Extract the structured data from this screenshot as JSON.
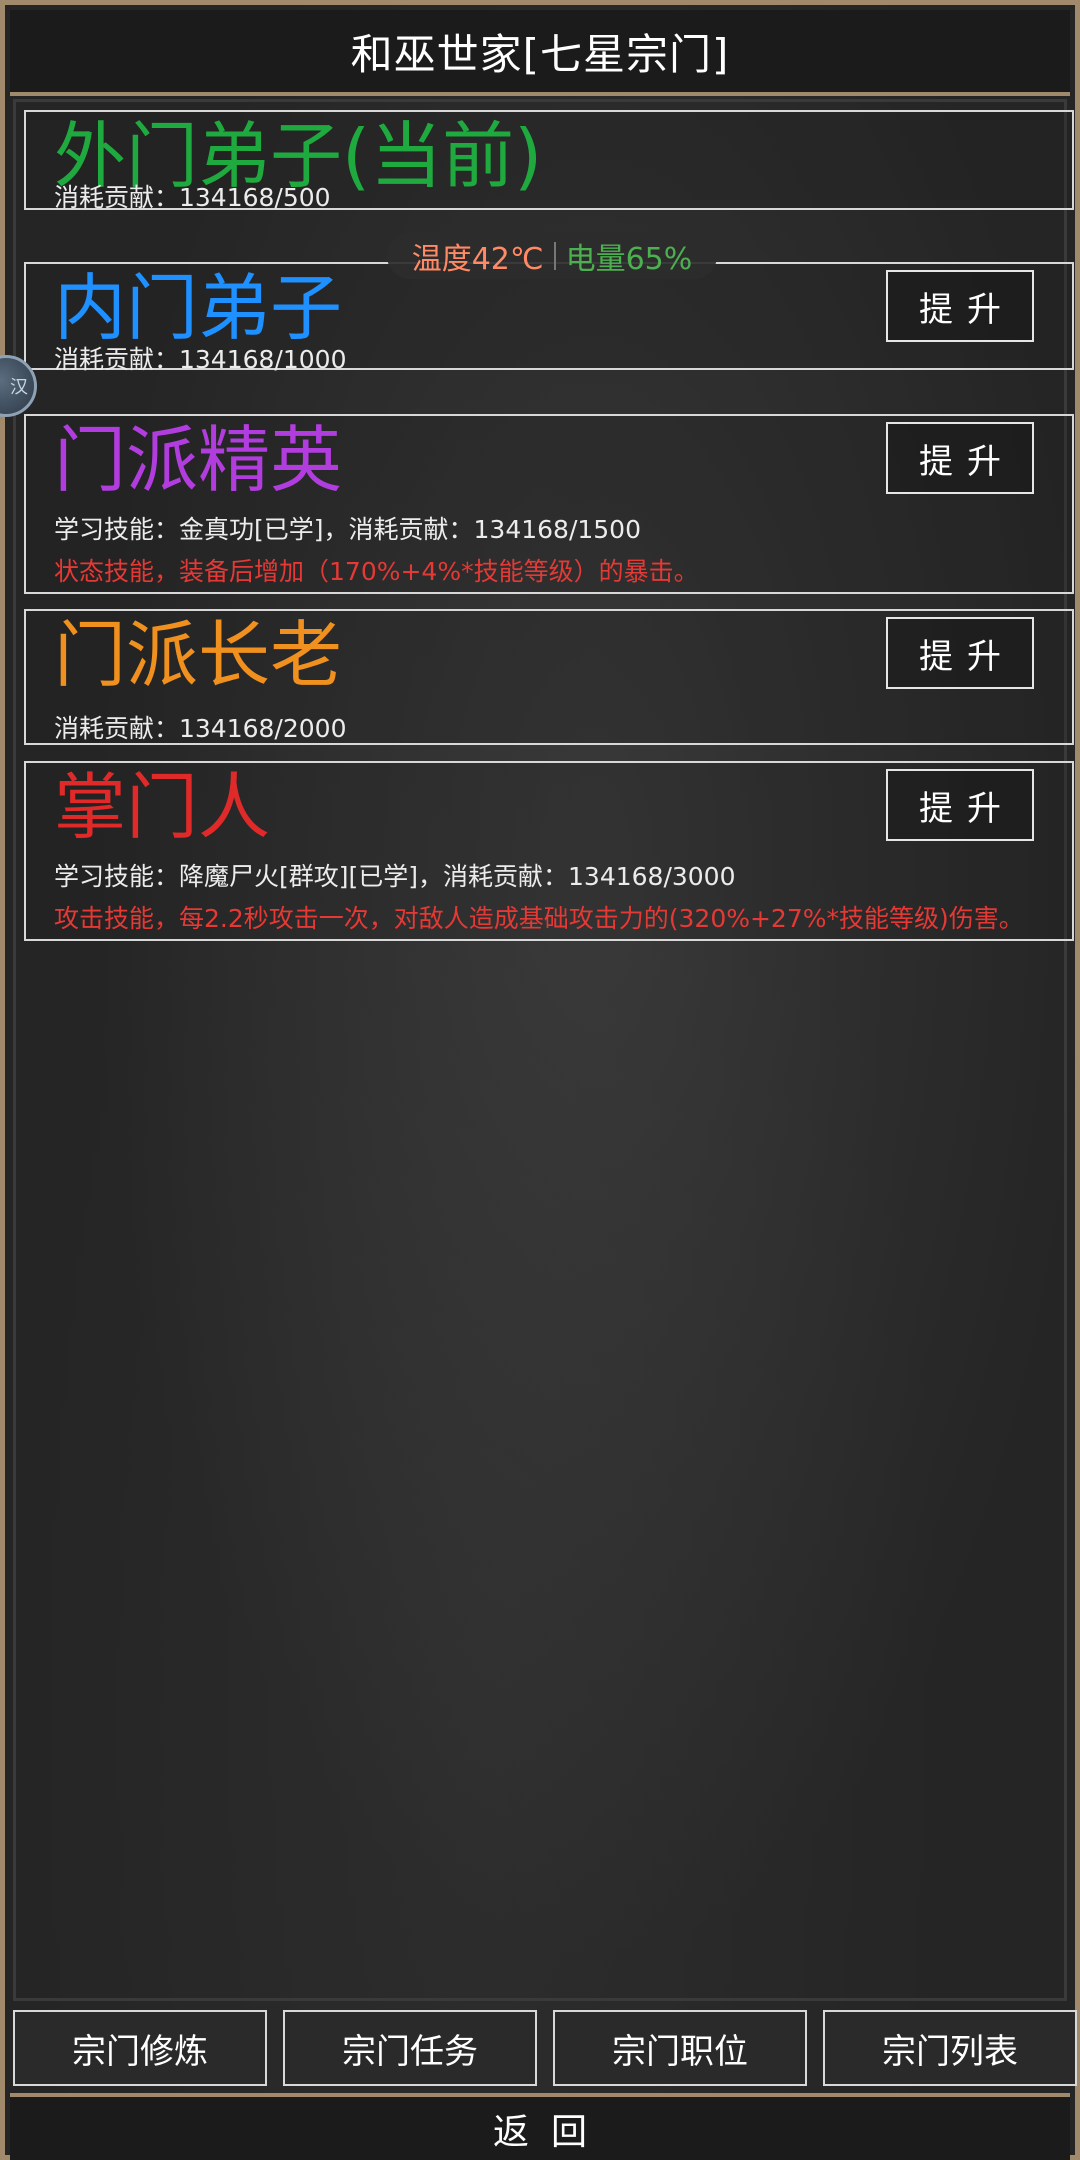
{
  "header": {
    "title": "和巫世家[七星宗门]"
  },
  "status": {
    "temperature": "温度42℃",
    "battery": "电量65%",
    "temperature_color": "#ff8a65",
    "battery_color": "#4caf50"
  },
  "float_button": {
    "label": "汉"
  },
  "ranks": [
    {
      "name": "外门弟子(当前)",
      "color": "#1faa3f",
      "info": "消耗贡献：134168/500",
      "desc": "",
      "button": ""
    },
    {
      "name": "内门弟子",
      "color": "#1e90ff",
      "info": "消耗贡献：134168/1000",
      "desc": "",
      "button": "提升"
    },
    {
      "name": "门派精英",
      "color": "#b23ddf",
      "info": "学习技能：金真功[已学]，消耗贡献：134168/1500",
      "desc": "状态技能，装备后增加（170%+4%*技能等级）的暴击。",
      "button": "提升"
    },
    {
      "name": "门派长老",
      "color": "#f0901e",
      "info": "消耗贡献：134168/2000",
      "desc": "",
      "button": "提升"
    },
    {
      "name": "掌门人",
      "color": "#e02a2a",
      "info": "学习技能：降魔尸火[群攻][已学]，消耗贡献：134168/3000",
      "desc": "攻击技能，每2.2秒攻击一次，对敌人造成基础攻击力的(320%+27%*技能等级)伤害。",
      "button": "提升"
    }
  ],
  "tabs": [
    {
      "label": "宗门修炼"
    },
    {
      "label": "宗门任务"
    },
    {
      "label": "宗门职位"
    },
    {
      "label": "宗门列表"
    }
  ],
  "footer": {
    "return_label": "返回"
  },
  "colors": {
    "frame_border": "#a08a6b",
    "desc_red": "#e53935"
  }
}
